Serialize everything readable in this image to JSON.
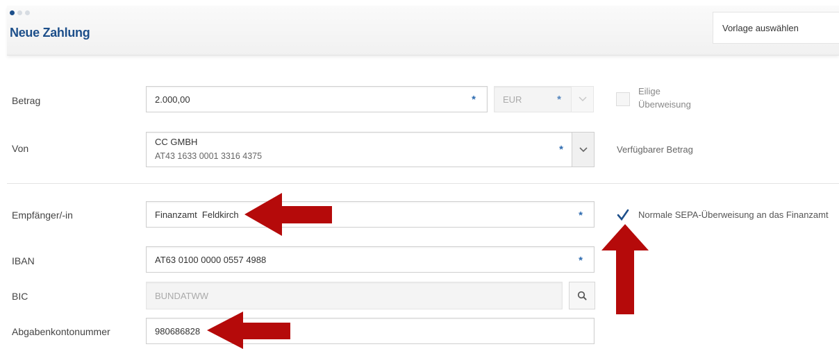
{
  "header": {
    "title": "Neue Zahlung",
    "template_select": "Vorlage auswählen",
    "steps": 3,
    "active_step": 1
  },
  "betrag": {
    "label": "Betrag",
    "value": "2.000,00",
    "currency": "EUR",
    "required": "*",
    "eilige_line1": "Eilige",
    "eilige_line2": "Überweisung"
  },
  "von": {
    "label": "Von",
    "name": "CC GMBH",
    "iban": "AT43 1633 0001 3316 4375",
    "required": "*",
    "available": "Verfügbarer Betrag"
  },
  "empfaenger": {
    "label": "Empfänger/-in",
    "value": "Finanzamt  Feldkirch",
    "required": "*",
    "sepa_checkbox_label": "Normale SEPA-Überweisung an das Finanzamt",
    "sepa_checked": true
  },
  "iban": {
    "label": "IBAN",
    "value": "AT63 0100 0000 0557 4988",
    "required": "*"
  },
  "bic": {
    "label": "BIC",
    "value": "BUNDATWW"
  },
  "abgaben": {
    "label": "Abgabenkontonummer",
    "value": "980686828"
  },
  "colors": {
    "accent": "#1d4f8a",
    "required": "#2d6bb0",
    "annotation_arrow": "#b50a0a"
  }
}
